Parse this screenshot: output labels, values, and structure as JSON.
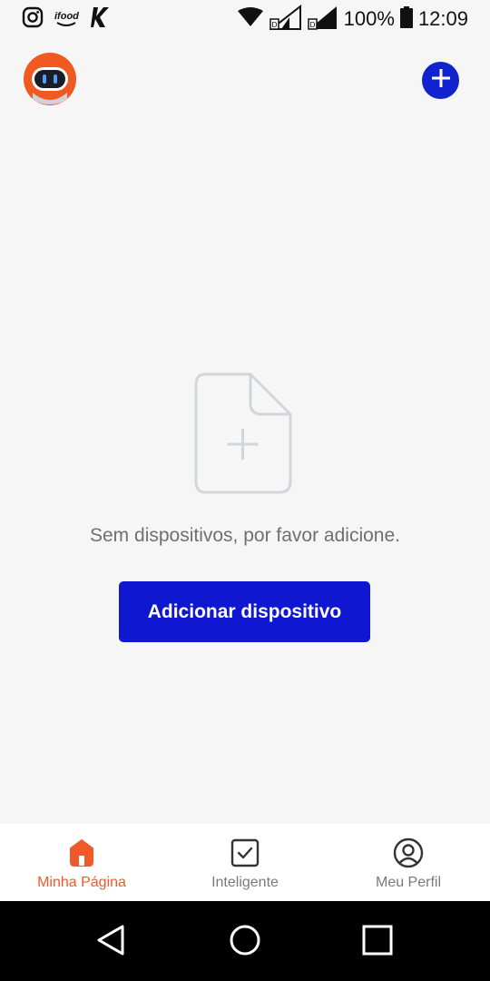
{
  "status_bar": {
    "left_icons": [
      "instagram-icon",
      "ifood-icon",
      "k-app-icon"
    ],
    "ifood_text": "ifood",
    "battery_text": "100%",
    "time": "12:09"
  },
  "header": {
    "avatar_icon": "robot-avatar-icon",
    "add_icon": "plus-circle-icon"
  },
  "empty_state": {
    "icon": "file-add-icon",
    "message": "Sem dispositivos, por favor adicione.",
    "button_label": "Adicionar dispositivo"
  },
  "tabs": [
    {
      "label": "Minha Página",
      "icon": "home-icon",
      "active": true
    },
    {
      "label": "Inteligente",
      "icon": "checkbox-icon",
      "active": false
    },
    {
      "label": "Meu Perfil",
      "icon": "profile-icon",
      "active": false
    }
  ],
  "colors": {
    "accent": "#1017d0",
    "active_tab": "#f0592a",
    "inactive_tab": "#7a7a7e",
    "background": "#f6f6f7"
  }
}
